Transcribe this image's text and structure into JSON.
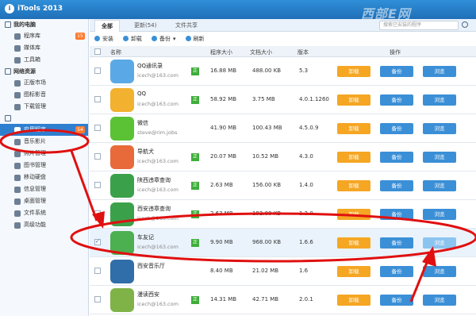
{
  "app": {
    "title": "iTools 2013",
    "logo_letter": "i",
    "watermark": "西部E网"
  },
  "sidebar": {
    "groups": [
      {
        "title": "我的电脑",
        "items": [
          {
            "label": "程序库",
            "badge": "15"
          },
          {
            "label": "媒体库"
          },
          {
            "label": "工具箱"
          }
        ]
      },
      {
        "title": "网络资源",
        "items": [
          {
            "label": "正版市场"
          },
          {
            "label": "图标影音"
          },
          {
            "label": "下载管理"
          }
        ]
      },
      {
        "title": "",
        "items": [
          {
            "label": "应用程序",
            "badge": "54",
            "active": true
          },
          {
            "label": "音乐影片"
          },
          {
            "label": "照片管理"
          },
          {
            "label": "图书管理"
          },
          {
            "label": "移动硬盘"
          },
          {
            "label": "信息管理"
          },
          {
            "label": "桌面管理"
          },
          {
            "label": "文件系统"
          },
          {
            "label": "高级功能"
          }
        ]
      }
    ]
  },
  "tabs": [
    {
      "label": "全部"
    },
    {
      "label": "更新(54)"
    },
    {
      "label": "文件共享"
    }
  ],
  "search": {
    "placeholder": "搜索已安装的程序"
  },
  "toolbar": {
    "install": "安装",
    "uninstall": "卸载",
    "backup": "备份",
    "refresh": "刷新"
  },
  "columns": {
    "name": "名称",
    "prog_size": "程序大小",
    "doc_size": "文档大小",
    "version": "版本",
    "actions": "操作"
  },
  "rows": [
    {
      "name": "QQ通讯录",
      "account": "icech@163.com",
      "green": "正",
      "prog": "16.88 MB",
      "doc": "488.00 KB",
      "ver": "5.3",
      "icon_color": "#5aa9e6",
      "selected": false
    },
    {
      "name": "QQ",
      "account": "icech@163.com",
      "green": "正",
      "prog": "58.92 MB",
      "doc": "3.75 MB",
      "ver": "4.0.1.1260",
      "icon_color": "#f2b12f",
      "selected": false
    },
    {
      "name": "微信",
      "account": "steve@rim.jobs",
      "green": "",
      "prog": "41.90 MB",
      "doc": "100.43 MB",
      "ver": "4.5.0.9",
      "icon_color": "#5bc236",
      "selected": false
    },
    {
      "name": "导航犬",
      "account": "icech@163.com",
      "green": "正",
      "prog": "20.07 MB",
      "doc": "10.52 MB",
      "ver": "4.3.0",
      "icon_color": "#e86a3a",
      "selected": false
    },
    {
      "name": "陕西违章查询",
      "account": "icech@163.com",
      "green": "正",
      "prog": "2.63 MB",
      "doc": "156.00 KB",
      "ver": "1.4.0",
      "icon_color": "#3aa14a",
      "selected": false
    },
    {
      "name": "西安违章查询",
      "account": "icech@163.com",
      "green": "正",
      "prog": "2.63 MB",
      "doc": "192.00 KB",
      "ver": "1.2.0",
      "icon_color": "#3aa14a",
      "selected": false
    },
    {
      "name": "车友记",
      "account": "icech@163.com",
      "green": "正",
      "prog": "9.90 MB",
      "doc": "968.00 KB",
      "ver": "1.6.6",
      "icon_color": "#4caf50",
      "selected": true
    },
    {
      "name": "西安音乐厅",
      "account": "",
      "green": "",
      "prog": "8.40 MB",
      "doc": "21.02 MB",
      "ver": "1.6",
      "icon_color": "#2f6ea8",
      "selected": false
    },
    {
      "name": "漫读西安",
      "account": "icech@163.com",
      "green": "正",
      "prog": "14.31 MB",
      "doc": "42.71 MB",
      "ver": "2.0.1",
      "icon_color": "#7fb347",
      "selected": false
    }
  ],
  "row_buttons": {
    "uninstall": "卸载",
    "backup": "备份",
    "browse": "浏览"
  },
  "colors": {
    "accent": "#2f7fd0",
    "orange": "#f5a623",
    "annotation": "#e01010"
  }
}
